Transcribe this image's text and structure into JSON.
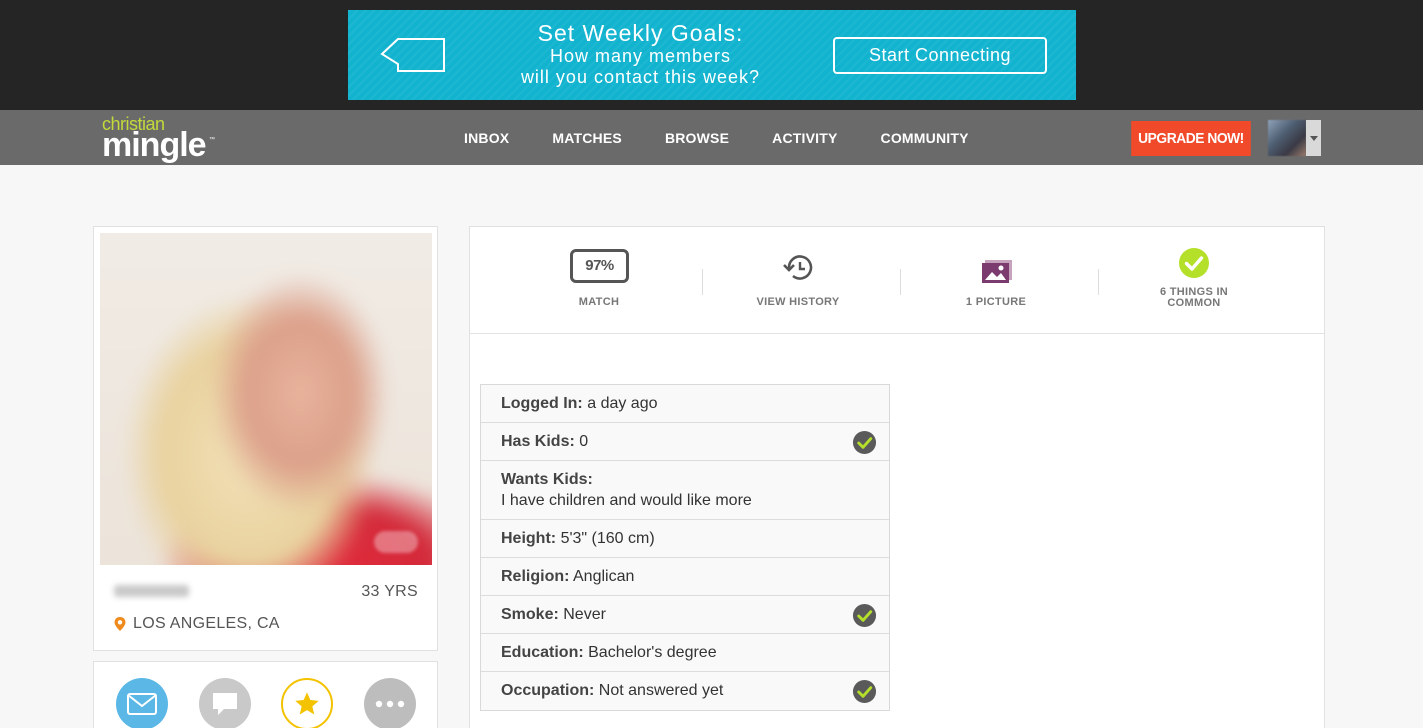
{
  "ad": {
    "title": "Set Weekly Goals:",
    "line1": "How many members",
    "line2": "will you contact this week?",
    "cta": "Start Connecting"
  },
  "nav": {
    "logo_top": "christian",
    "logo_bottom": "mingle",
    "logo_tm": "™",
    "links": [
      "INBOX",
      "MATCHES",
      "BROWSE",
      "ACTIVITY",
      "COMMUNITY"
    ],
    "upgrade": "UPGRADE NOW!"
  },
  "profile": {
    "age": "33 YRS",
    "location": "LOS ANGELES, CA"
  },
  "stats": {
    "match_value": "97%",
    "match_label": "MATCH",
    "history_label": "VIEW HISTORY",
    "pictures_label": "1 PICTURE",
    "common_line1": "6 THINGS IN",
    "common_line2": "COMMON"
  },
  "details": [
    {
      "key": "Logged In:",
      "value": "a day ago",
      "check": false
    },
    {
      "key": "Has Kids:",
      "value": "0",
      "check": true
    },
    {
      "key": "Wants Kids:",
      "value": "I have children and would like more",
      "check": false
    },
    {
      "key": "Height:",
      "value": "5'3\" (160 cm)",
      "check": false
    },
    {
      "key": "Religion:",
      "value": "Anglican",
      "check": false
    },
    {
      "key": "Smoke:",
      "value": "Never",
      "check": true
    },
    {
      "key": "Education:",
      "value": "Bachelor's degree",
      "check": false
    },
    {
      "key": "Occupation:",
      "value": "Not answered yet",
      "check": true
    }
  ],
  "colors": {
    "ad_bg": "#12b3cf",
    "navbar": "#6a6a6a",
    "upgrade": "#f04a2a",
    "logo_accent": "#c4d93a",
    "check_green": "#b5e02a"
  }
}
